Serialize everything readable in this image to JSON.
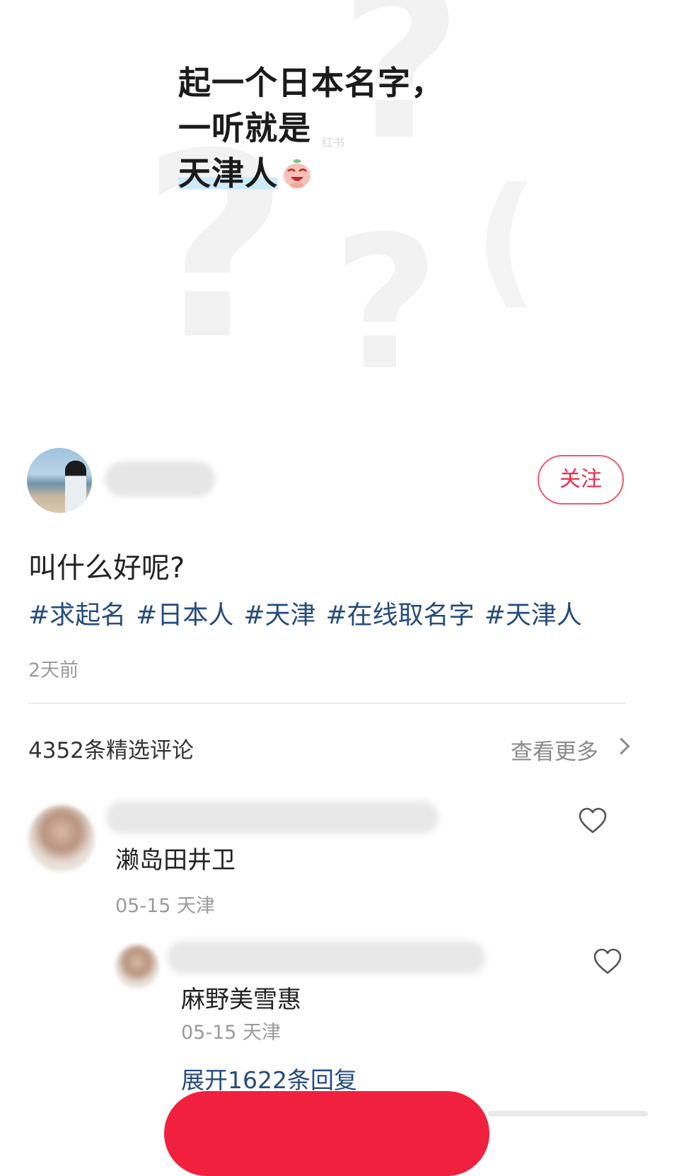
{
  "cover": {
    "title_line1": "起一个日本名字，",
    "title_line2": "一听就是",
    "title_line3": "天津人",
    "emoji": "laughing-face-sticker",
    "watermark": "红书"
  },
  "author": {
    "avatar": "beach-avatar",
    "follow_label": "关注"
  },
  "post": {
    "title": "叫什么好呢?",
    "tags": [
      "#求起名",
      "#日本人",
      "#天津",
      "#在线取名字",
      "#天津人"
    ],
    "time": "2天前"
  },
  "comments_header": {
    "count_label": "4352条精选评论",
    "see_more": "查看更多"
  },
  "comments": [
    {
      "text": "濑岛田井卫",
      "meta": "05-15 天津",
      "icon": "heart-icon"
    },
    {
      "text": "麻野美雪惠",
      "meta": "05-15 天津",
      "icon": "heart-icon"
    }
  ],
  "expand_replies": "展开1622条回复",
  "colors": {
    "accent_red": "#ee2d4d",
    "tag_blue": "#264b7c",
    "meta_gray": "#9a9a9a"
  }
}
